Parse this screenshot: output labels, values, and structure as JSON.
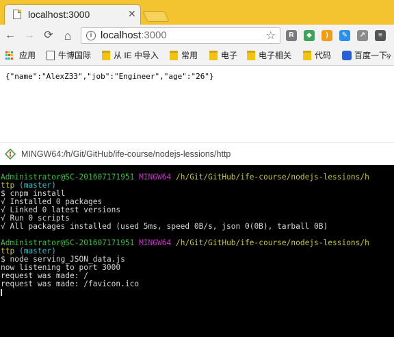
{
  "browser": {
    "tab": {
      "title": "localhost:3000",
      "close_glyph": "✕"
    },
    "toolbar": {
      "back_icon": "←",
      "forward_icon": "→",
      "reload_icon": "⟳",
      "home_icon": "⌂",
      "url_host": "localhost",
      "url_port": ":3000",
      "star_icon": "☆",
      "extensions": [
        {
          "name": "R",
          "color": "#7a7a7a"
        },
        {
          "name": "◆",
          "color": "#3aa655"
        },
        {
          "name": ")",
          "color": "#f39c12"
        },
        {
          "name": "✎",
          "color": "#2b8ff0"
        },
        {
          "name": "↗",
          "color": "#8c8c8c"
        },
        {
          "name": "≡",
          "color": "#555555"
        }
      ]
    },
    "bookmarks": [
      {
        "label": "应用",
        "icon": "apps-icon"
      },
      {
        "label": "牛博国际",
        "icon": "page-icon"
      },
      {
        "label": "从 IE 中导入",
        "icon": "folder-icon"
      },
      {
        "label": "常用",
        "icon": "folder-icon"
      },
      {
        "label": "电子",
        "icon": "folder-icon"
      },
      {
        "label": "电子相关",
        "icon": "folder-icon"
      },
      {
        "label": "代码",
        "icon": "folder-icon"
      },
      {
        "label": "百度一下，",
        "icon": "paw-icon"
      }
    ],
    "bookmarks_more": "»"
  },
  "page": {
    "json_text": "{\"name\":\"AlexZ33\",\"job\":\"Engineer\",\"age\":\"26\"}"
  },
  "terminal": {
    "title": "MINGW64:/h/Git/GitHub/ife-course/nodejs-lessions/http",
    "prompt": {
      "user_host": "Administrator@SC-201607171951",
      "env": "MINGW64",
      "path_line1": "/h/Git/GitHub/ife-course/nodejs-lessions/h",
      "path_line2": "ttp",
      "branch": "(master)",
      "symbol": "$"
    },
    "session1": {
      "command": "cnpm install",
      "output": [
        "√ Installed 0 packages",
        "√ Linked 0 latest versions",
        "√ Run 0 scripts",
        "√ All packages installed (used 5ms, speed 0B/s, json 0(0B), tarball 0B)"
      ]
    },
    "session2": {
      "command": "node serving_JSON_data.js",
      "output": [
        "now listening to port 3000",
        "request was made: /",
        "request was made: /favicon.ico"
      ]
    }
  },
  "colors": {
    "tabstrip": "#f4c430",
    "terminal_bg": "#000000",
    "prompt_green": "#35c235",
    "prompt_magenta": "#c537c5",
    "prompt_yellow": "#c7c43a",
    "prompt_cyan": "#3ab6c4"
  }
}
